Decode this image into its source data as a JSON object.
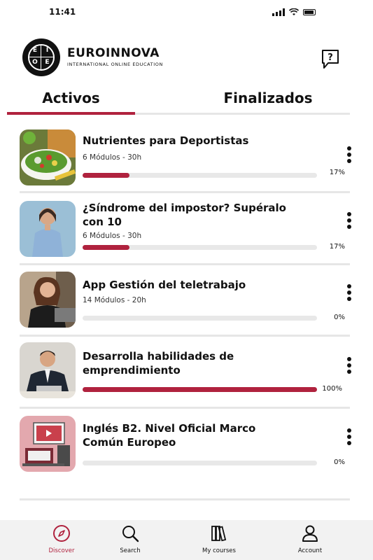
{
  "status": {
    "time": "11:41"
  },
  "brand": {
    "name": "EUROINNOVA",
    "tagline": "INTERNATIONAL ONLINE EDUCATION",
    "logo_letters": [
      "E",
      "I",
      "O",
      "E"
    ]
  },
  "tabs": [
    {
      "label": "Activos",
      "active": true
    },
    {
      "label": "Finalizados",
      "active": false
    }
  ],
  "courses": [
    {
      "title": "Nutrientes para Deportistas",
      "meta": "6 Módulos - 30h",
      "progress_label": "17%",
      "progress": 0.17,
      "thumb": "salad-image"
    },
    {
      "title": "¿Síndrome del impostor? Supéralo con 10",
      "meta": "6 Módulos - 30h",
      "progress_label": "17%",
      "progress": 0.17,
      "thumb": "woman-portrait-image"
    },
    {
      "title": "App Gestión del teletrabajo",
      "meta": "14 Módulos - 20h",
      "progress_label": "0%",
      "progress": 0.0,
      "thumb": "woman-laptop-image"
    },
    {
      "title": "Desarrolla habilidades de emprendimiento",
      "meta": "",
      "progress_label": "100%",
      "progress": 1.0,
      "thumb": "businessman-image"
    },
    {
      "title": "Inglés B2. Nivel Oficial Marco Común Europeo",
      "meta": "",
      "progress_label": "0%",
      "progress": 0.0,
      "thumb": "online-learning-illustration"
    }
  ],
  "nav": [
    {
      "label": "Discover",
      "icon": "compass-icon",
      "active": true
    },
    {
      "label": "Search",
      "icon": "search-icon",
      "active": false
    },
    {
      "label": "My courses",
      "icon": "books-icon",
      "active": false
    },
    {
      "label": "Account",
      "icon": "user-icon",
      "active": false
    }
  ],
  "colors": {
    "accent": "#b0223e",
    "track": "#e8e8e8",
    "nav_bg": "#f2f2f2"
  }
}
